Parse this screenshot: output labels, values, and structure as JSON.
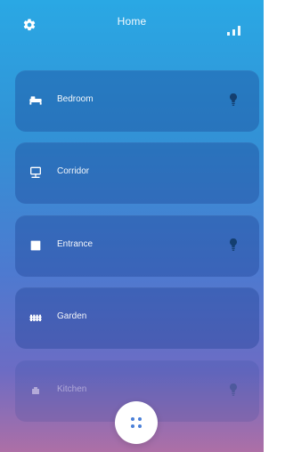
{
  "header": {
    "title": "Home",
    "left_icon": "gear-icon",
    "right_icon": "signal-bars-icon"
  },
  "rooms": [
    {
      "label": "Bedroom",
      "icon": "bed-icon",
      "bulb": "light-bulb-icon"
    },
    {
      "label": "Corridor",
      "icon": "lamp-icon"
    },
    {
      "label": "Entrance",
      "icon": "door-icon",
      "bulb": "light-bulb-icon"
    },
    {
      "label": "Garden",
      "icon": "fence-icon"
    },
    {
      "label": "Kitchen",
      "icon": "kitchen-icon",
      "bulb": "light-bulb-icon"
    }
  ],
  "fab": {
    "icon": "grid-dots-icon"
  },
  "colors": {
    "background_top": "#2aa8e4",
    "background_bottom": "#ad6fa6",
    "card": "#173b8d",
    "icon_dark": "#143f70",
    "fab": "#ffffff"
  }
}
